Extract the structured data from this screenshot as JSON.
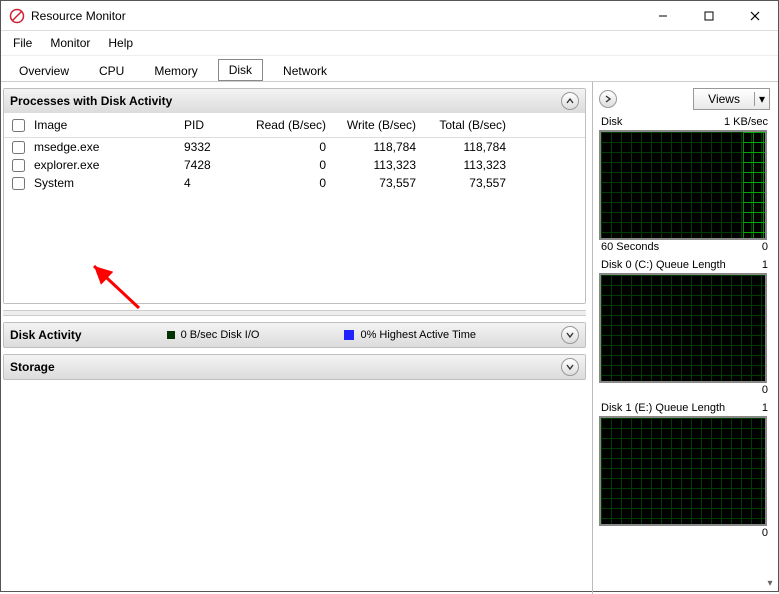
{
  "window": {
    "title": "Resource Monitor"
  },
  "menu": {
    "items": [
      "File",
      "Monitor",
      "Help"
    ]
  },
  "tabs": {
    "items": [
      "Overview",
      "CPU",
      "Memory",
      "Disk",
      "Network"
    ],
    "active": "Disk"
  },
  "processes_section": {
    "title": "Processes with Disk Activity",
    "columns": {
      "image": "Image",
      "pid": "PID",
      "read": "Read (B/sec)",
      "write": "Write (B/sec)",
      "total": "Total (B/sec)"
    },
    "rows": [
      {
        "image": "msedge.exe",
        "pid": "9332",
        "read": "0",
        "write": "118,784",
        "total": "118,784"
      },
      {
        "image": "explorer.exe",
        "pid": "7428",
        "read": "0",
        "write": "113,323",
        "total": "113,323"
      },
      {
        "image": "System",
        "pid": "4",
        "read": "0",
        "write": "73,557",
        "total": "73,557"
      }
    ]
  },
  "disk_activity_section": {
    "title": "Disk Activity",
    "io_label": "0 B/sec Disk I/O",
    "active_label": "0% Highest Active Time"
  },
  "storage_section": {
    "title": "Storage"
  },
  "side": {
    "views_label": "Views",
    "graphs": [
      {
        "title": "Disk",
        "top_right": "1 KB/sec",
        "foot_left": "60 Seconds",
        "foot_right": "0",
        "bright": true
      },
      {
        "title": "Disk 0 (C:) Queue Length",
        "top_right": "1",
        "foot_left": "",
        "foot_right": "0",
        "bright": false
      },
      {
        "title": "Disk 1 (E:) Queue Length",
        "top_right": "1",
        "foot_left": "",
        "foot_right": "0",
        "bright": false
      }
    ]
  }
}
